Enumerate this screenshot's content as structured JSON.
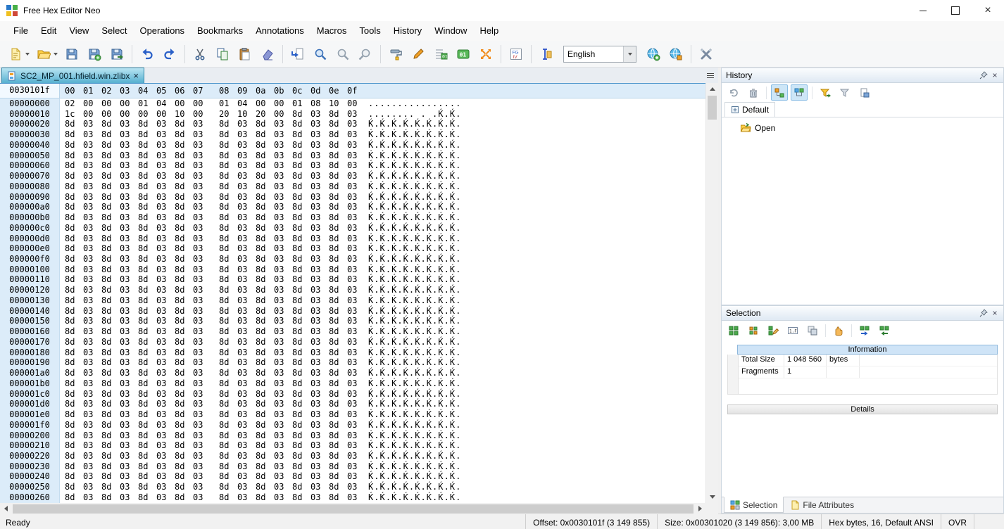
{
  "window": {
    "title": "Free Hex Editor Neo",
    "controls": [
      "minimize",
      "maximize",
      "close"
    ]
  },
  "menu_bar": {
    "items": [
      "File",
      "Edit",
      "View",
      "Select",
      "Operations",
      "Bookmarks",
      "Annotations",
      "Macros",
      "Tools",
      "History",
      "Window",
      "Help"
    ]
  },
  "toolbar": {
    "language_select": "English",
    "icons": [
      "new-file",
      "open-file",
      "save",
      "save-as",
      "save-all",
      "undo",
      "redo",
      "cut",
      "copy",
      "paste",
      "delete",
      "goto-offset",
      "find",
      "find-next",
      "find-previous",
      "fill",
      "edit-pencil",
      "insert-bits",
      "binary-01",
      "swap-bytes",
      "structure-viewer",
      "caret-mode",
      "add-language",
      "language-settings",
      "settings-tools"
    ]
  },
  "document_tab": {
    "title": "SC2_MP_001.hfield.win.zlibx"
  },
  "hex_view": {
    "current_offset": "0030101f",
    "columns": [
      "00",
      "01",
      "02",
      "03",
      "04",
      "05",
      "06",
      "07",
      "08",
      "09",
      "0a",
      "0b",
      "0c",
      "0d",
      "0e",
      "0f"
    ],
    "rows": [
      {
        "addr": "00000000",
        "hex": "02 00 00 00 01 04 00 00 01 04 00 00 01 08 10 00",
        "ascii": "................"
      },
      {
        "addr": "00000010",
        "hex": "1c 00 00 00 00 00 10 00 20 10 20 00 8d 03 8d 03",
        "ascii": "........ . .Ќ.Ќ."
      },
      {
        "addr": "00000020",
        "hex": "8d 03 8d 03 8d 03 8d 03 8d 03 8d 03 8d 03 8d 03",
        "ascii": "Ќ.Ќ.Ќ.Ќ.Ќ.Ќ.Ќ.Ќ."
      },
      {
        "addr": "00000030",
        "hex": "8d 03 8d 03 8d 03 8d 03 8d 03 8d 03 8d 03 8d 03",
        "ascii": "Ќ.Ќ.Ќ.Ќ.Ќ.Ќ.Ќ.Ќ."
      },
      {
        "addr": "00000040",
        "hex": "8d 03 8d 03 8d 03 8d 03 8d 03 8d 03 8d 03 8d 03",
        "ascii": "Ќ.Ќ.Ќ.Ќ.Ќ.Ќ.Ќ.Ќ."
      },
      {
        "addr": "00000050",
        "hex": "8d 03 8d 03 8d 03 8d 03 8d 03 8d 03 8d 03 8d 03",
        "ascii": "Ќ.Ќ.Ќ.Ќ.Ќ.Ќ.Ќ.Ќ."
      },
      {
        "addr": "00000060",
        "hex": "8d 03 8d 03 8d 03 8d 03 8d 03 8d 03 8d 03 8d 03",
        "ascii": "Ќ.Ќ.Ќ.Ќ.Ќ.Ќ.Ќ.Ќ."
      },
      {
        "addr": "00000070",
        "hex": "8d 03 8d 03 8d 03 8d 03 8d 03 8d 03 8d 03 8d 03",
        "ascii": "Ќ.Ќ.Ќ.Ќ.Ќ.Ќ.Ќ.Ќ."
      },
      {
        "addr": "00000080",
        "hex": "8d 03 8d 03 8d 03 8d 03 8d 03 8d 03 8d 03 8d 03",
        "ascii": "Ќ.Ќ.Ќ.Ќ.Ќ.Ќ.Ќ.Ќ."
      },
      {
        "addr": "00000090",
        "hex": "8d 03 8d 03 8d 03 8d 03 8d 03 8d 03 8d 03 8d 03",
        "ascii": "Ќ.Ќ.Ќ.Ќ.Ќ.Ќ.Ќ.Ќ."
      },
      {
        "addr": "000000a0",
        "hex": "8d 03 8d 03 8d 03 8d 03 8d 03 8d 03 8d 03 8d 03",
        "ascii": "Ќ.Ќ.Ќ.Ќ.Ќ.Ќ.Ќ.Ќ."
      },
      {
        "addr": "000000b0",
        "hex": "8d 03 8d 03 8d 03 8d 03 8d 03 8d 03 8d 03 8d 03",
        "ascii": "Ќ.Ќ.Ќ.Ќ.Ќ.Ќ.Ќ.Ќ."
      },
      {
        "addr": "000000c0",
        "hex": "8d 03 8d 03 8d 03 8d 03 8d 03 8d 03 8d 03 8d 03",
        "ascii": "Ќ.Ќ.Ќ.Ќ.Ќ.Ќ.Ќ.Ќ."
      },
      {
        "addr": "000000d0",
        "hex": "8d 03 8d 03 8d 03 8d 03 8d 03 8d 03 8d 03 8d 03",
        "ascii": "Ќ.Ќ.Ќ.Ќ.Ќ.Ќ.Ќ.Ќ."
      },
      {
        "addr": "000000e0",
        "hex": "8d 03 8d 03 8d 03 8d 03 8d 03 8d 03 8d 03 8d 03",
        "ascii": "Ќ.Ќ.Ќ.Ќ.Ќ.Ќ.Ќ.Ќ."
      },
      {
        "addr": "000000f0",
        "hex": "8d 03 8d 03 8d 03 8d 03 8d 03 8d 03 8d 03 8d 03",
        "ascii": "Ќ.Ќ.Ќ.Ќ.Ќ.Ќ.Ќ.Ќ."
      },
      {
        "addr": "00000100",
        "hex": "8d 03 8d 03 8d 03 8d 03 8d 03 8d 03 8d 03 8d 03",
        "ascii": "Ќ.Ќ.Ќ.Ќ.Ќ.Ќ.Ќ.Ќ."
      },
      {
        "addr": "00000110",
        "hex": "8d 03 8d 03 8d 03 8d 03 8d 03 8d 03 8d 03 8d 03",
        "ascii": "Ќ.Ќ.Ќ.Ќ.Ќ.Ќ.Ќ.Ќ."
      },
      {
        "addr": "00000120",
        "hex": "8d 03 8d 03 8d 03 8d 03 8d 03 8d 03 8d 03 8d 03",
        "ascii": "Ќ.Ќ.Ќ.Ќ.Ќ.Ќ.Ќ.Ќ."
      },
      {
        "addr": "00000130",
        "hex": "8d 03 8d 03 8d 03 8d 03 8d 03 8d 03 8d 03 8d 03",
        "ascii": "Ќ.Ќ.Ќ.Ќ.Ќ.Ќ.Ќ.Ќ."
      },
      {
        "addr": "00000140",
        "hex": "8d 03 8d 03 8d 03 8d 03 8d 03 8d 03 8d 03 8d 03",
        "ascii": "Ќ.Ќ.Ќ.Ќ.Ќ.Ќ.Ќ.Ќ."
      },
      {
        "addr": "00000150",
        "hex": "8d 03 8d 03 8d 03 8d 03 8d 03 8d 03 8d 03 8d 03",
        "ascii": "Ќ.Ќ.Ќ.Ќ.Ќ.Ќ.Ќ.Ќ."
      },
      {
        "addr": "00000160",
        "hex": "8d 03 8d 03 8d 03 8d 03 8d 03 8d 03 8d 03 8d 03",
        "ascii": "Ќ.Ќ.Ќ.Ќ.Ќ.Ќ.Ќ.Ќ."
      },
      {
        "addr": "00000170",
        "hex": "8d 03 8d 03 8d 03 8d 03 8d 03 8d 03 8d 03 8d 03",
        "ascii": "Ќ.Ќ.Ќ.Ќ.Ќ.Ќ.Ќ.Ќ."
      },
      {
        "addr": "00000180",
        "hex": "8d 03 8d 03 8d 03 8d 03 8d 03 8d 03 8d 03 8d 03",
        "ascii": "Ќ.Ќ.Ќ.Ќ.Ќ.Ќ.Ќ.Ќ."
      },
      {
        "addr": "00000190",
        "hex": "8d 03 8d 03 8d 03 8d 03 8d 03 8d 03 8d 03 8d 03",
        "ascii": "Ќ.Ќ.Ќ.Ќ.Ќ.Ќ.Ќ.Ќ."
      },
      {
        "addr": "000001a0",
        "hex": "8d 03 8d 03 8d 03 8d 03 8d 03 8d 03 8d 03 8d 03",
        "ascii": "Ќ.Ќ.Ќ.Ќ.Ќ.Ќ.Ќ.Ќ."
      },
      {
        "addr": "000001b0",
        "hex": "8d 03 8d 03 8d 03 8d 03 8d 03 8d 03 8d 03 8d 03",
        "ascii": "Ќ.Ќ.Ќ.Ќ.Ќ.Ќ.Ќ.Ќ."
      },
      {
        "addr": "000001c0",
        "hex": "8d 03 8d 03 8d 03 8d 03 8d 03 8d 03 8d 03 8d 03",
        "ascii": "Ќ.Ќ.Ќ.Ќ.Ќ.Ќ.Ќ.Ќ."
      },
      {
        "addr": "000001d0",
        "hex": "8d 03 8d 03 8d 03 8d 03 8d 03 8d 03 8d 03 8d 03",
        "ascii": "Ќ.Ќ.Ќ.Ќ.Ќ.Ќ.Ќ.Ќ."
      },
      {
        "addr": "000001e0",
        "hex": "8d 03 8d 03 8d 03 8d 03 8d 03 8d 03 8d 03 8d 03",
        "ascii": "Ќ.Ќ.Ќ.Ќ.Ќ.Ќ.Ќ.Ќ."
      },
      {
        "addr": "000001f0",
        "hex": "8d 03 8d 03 8d 03 8d 03 8d 03 8d 03 8d 03 8d 03",
        "ascii": "Ќ.Ќ.Ќ.Ќ.Ќ.Ќ.Ќ.Ќ."
      },
      {
        "addr": "00000200",
        "hex": "8d 03 8d 03 8d 03 8d 03 8d 03 8d 03 8d 03 8d 03",
        "ascii": "Ќ.Ќ.Ќ.Ќ.Ќ.Ќ.Ќ.Ќ."
      },
      {
        "addr": "00000210",
        "hex": "8d 03 8d 03 8d 03 8d 03 8d 03 8d 03 8d 03 8d 03",
        "ascii": "Ќ.Ќ.Ќ.Ќ.Ќ.Ќ.Ќ.Ќ."
      },
      {
        "addr": "00000220",
        "hex": "8d 03 8d 03 8d 03 8d 03 8d 03 8d 03 8d 03 8d 03",
        "ascii": "Ќ.Ќ.Ќ.Ќ.Ќ.Ќ.Ќ.Ќ."
      },
      {
        "addr": "00000230",
        "hex": "8d 03 8d 03 8d 03 8d 03 8d 03 8d 03 8d 03 8d 03",
        "ascii": "Ќ.Ќ.Ќ.Ќ.Ќ.Ќ.Ќ.Ќ."
      },
      {
        "addr": "00000240",
        "hex": "8d 03 8d 03 8d 03 8d 03 8d 03 8d 03 8d 03 8d 03",
        "ascii": "Ќ.Ќ.Ќ.Ќ.Ќ.Ќ.Ќ.Ќ."
      },
      {
        "addr": "00000250",
        "hex": "8d 03 8d 03 8d 03 8d 03 8d 03 8d 03 8d 03 8d 03",
        "ascii": "Ќ.Ќ.Ќ.Ќ.Ќ.Ќ.Ќ.Ќ."
      },
      {
        "addr": "00000260",
        "hex": "8d 03 8d 03 8d 03 8d 03 8d 03 8d 03 8d 03 8d 03",
        "ascii": "Ќ.Ќ.Ќ.Ќ.Ќ.Ќ.Ќ.Ќ."
      }
    ]
  },
  "history_panel": {
    "title": "History",
    "tab_label": "Default",
    "tree_items": [
      {
        "label": "Open"
      }
    ],
    "icons": [
      "clear-history",
      "delete-history",
      "show-hierarchy",
      "track-changes",
      "filter-apply",
      "filter-clear",
      "export-history"
    ]
  },
  "selection_panel": {
    "title": "Selection",
    "information_header": "Information",
    "table": {
      "rows": [
        {
          "label": "Total Size",
          "value": "1 048 560",
          "unit": "bytes"
        },
        {
          "label": "Fragments",
          "value": "1",
          "unit": ""
        }
      ]
    },
    "details_header": "Details",
    "bottom_tabs": [
      {
        "label": "Selection",
        "active": true
      },
      {
        "label": "File Attributes",
        "active": false
      }
    ],
    "icons": [
      "new-selection",
      "modify-selection",
      "edit-selection",
      "hex-format",
      "copy-selection",
      "pan",
      "save-selection",
      "load-selection"
    ]
  },
  "status_bar": {
    "ready": "Ready",
    "offset": "Offset: 0x0030101f (3 149 855)",
    "size": "Size: 0x00301020 (3 149 856): 3,00 MB",
    "format": "Hex bytes, 16, Default ANSI",
    "mode": "OVR"
  }
}
